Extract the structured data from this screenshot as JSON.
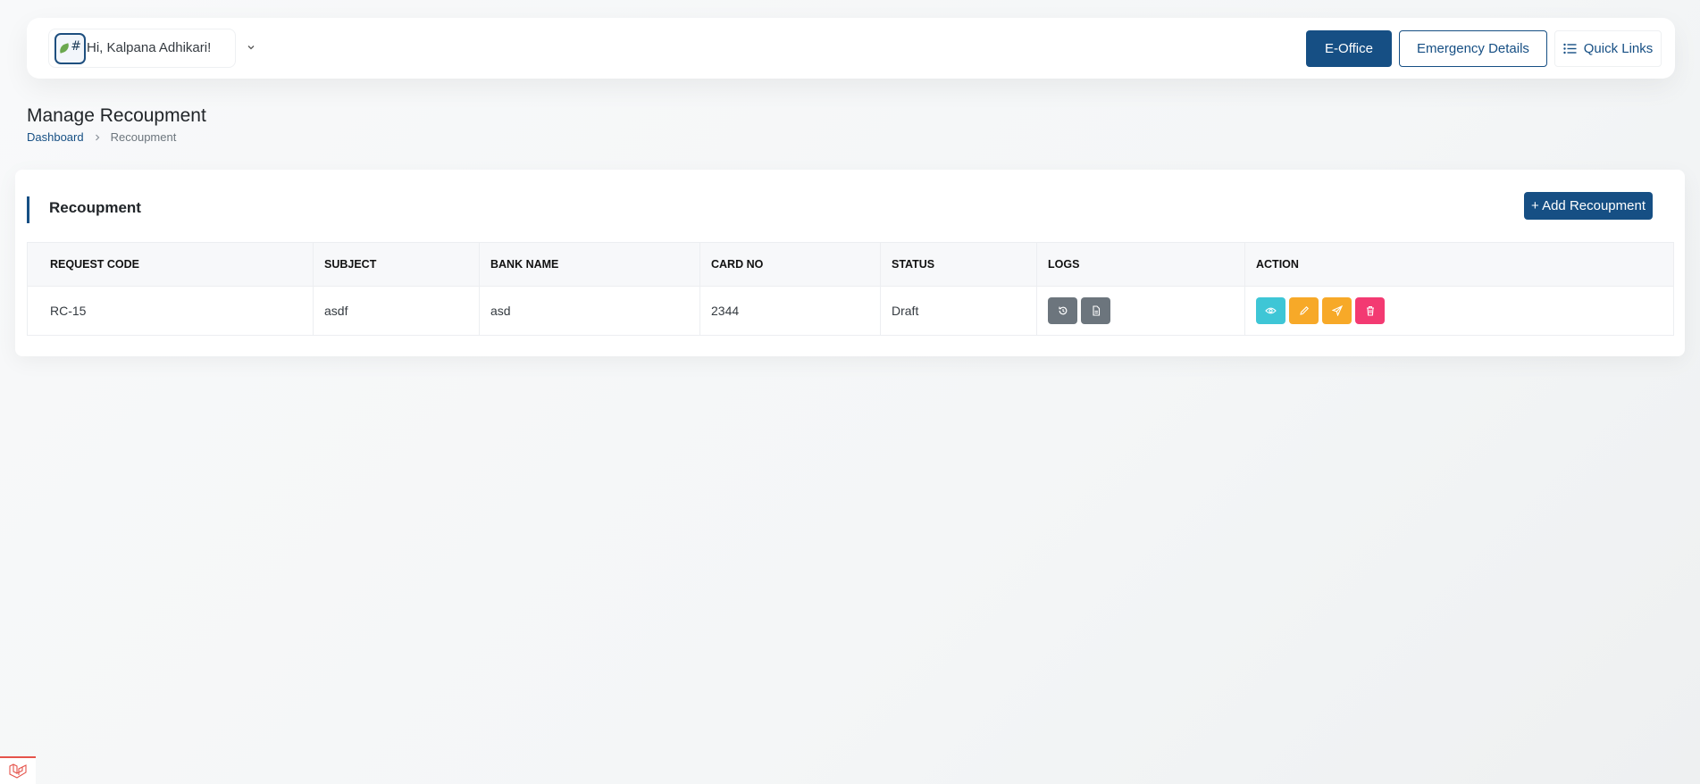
{
  "header": {
    "greeting": "Hi, Kalpana Adhikari!",
    "buttons": {
      "eoffice": "E-Office",
      "emergency": "Emergency Details",
      "quick_links": "Quick Links"
    }
  },
  "page": {
    "title": "Manage Recoupment",
    "breadcrumb": {
      "home": "Dashboard",
      "current": "Recoupment"
    }
  },
  "card": {
    "title": "Recoupment",
    "add_button": "+ Add Recoupment"
  },
  "table": {
    "headers": [
      "REQUEST CODE",
      "SUBJECT",
      "BANK NAME",
      "CARD NO",
      "STATUS",
      "LOGS",
      "ACTION"
    ],
    "rows": [
      {
        "request_code": "RC-15",
        "subject": "asdf",
        "bank_name": "asd",
        "card_no": "2344",
        "status": "Draft"
      }
    ]
  },
  "icons": {
    "logs": [
      "history-icon",
      "document-icon"
    ],
    "actions": [
      "eye-icon",
      "pencil-icon",
      "send-icon",
      "trash-icon"
    ]
  },
  "colors": {
    "primary": "#164f84",
    "view": "#3ec6d6",
    "edit": "#f7a928",
    "send": "#f7a928",
    "delete": "#f33a72",
    "logs": "#6c757d"
  }
}
